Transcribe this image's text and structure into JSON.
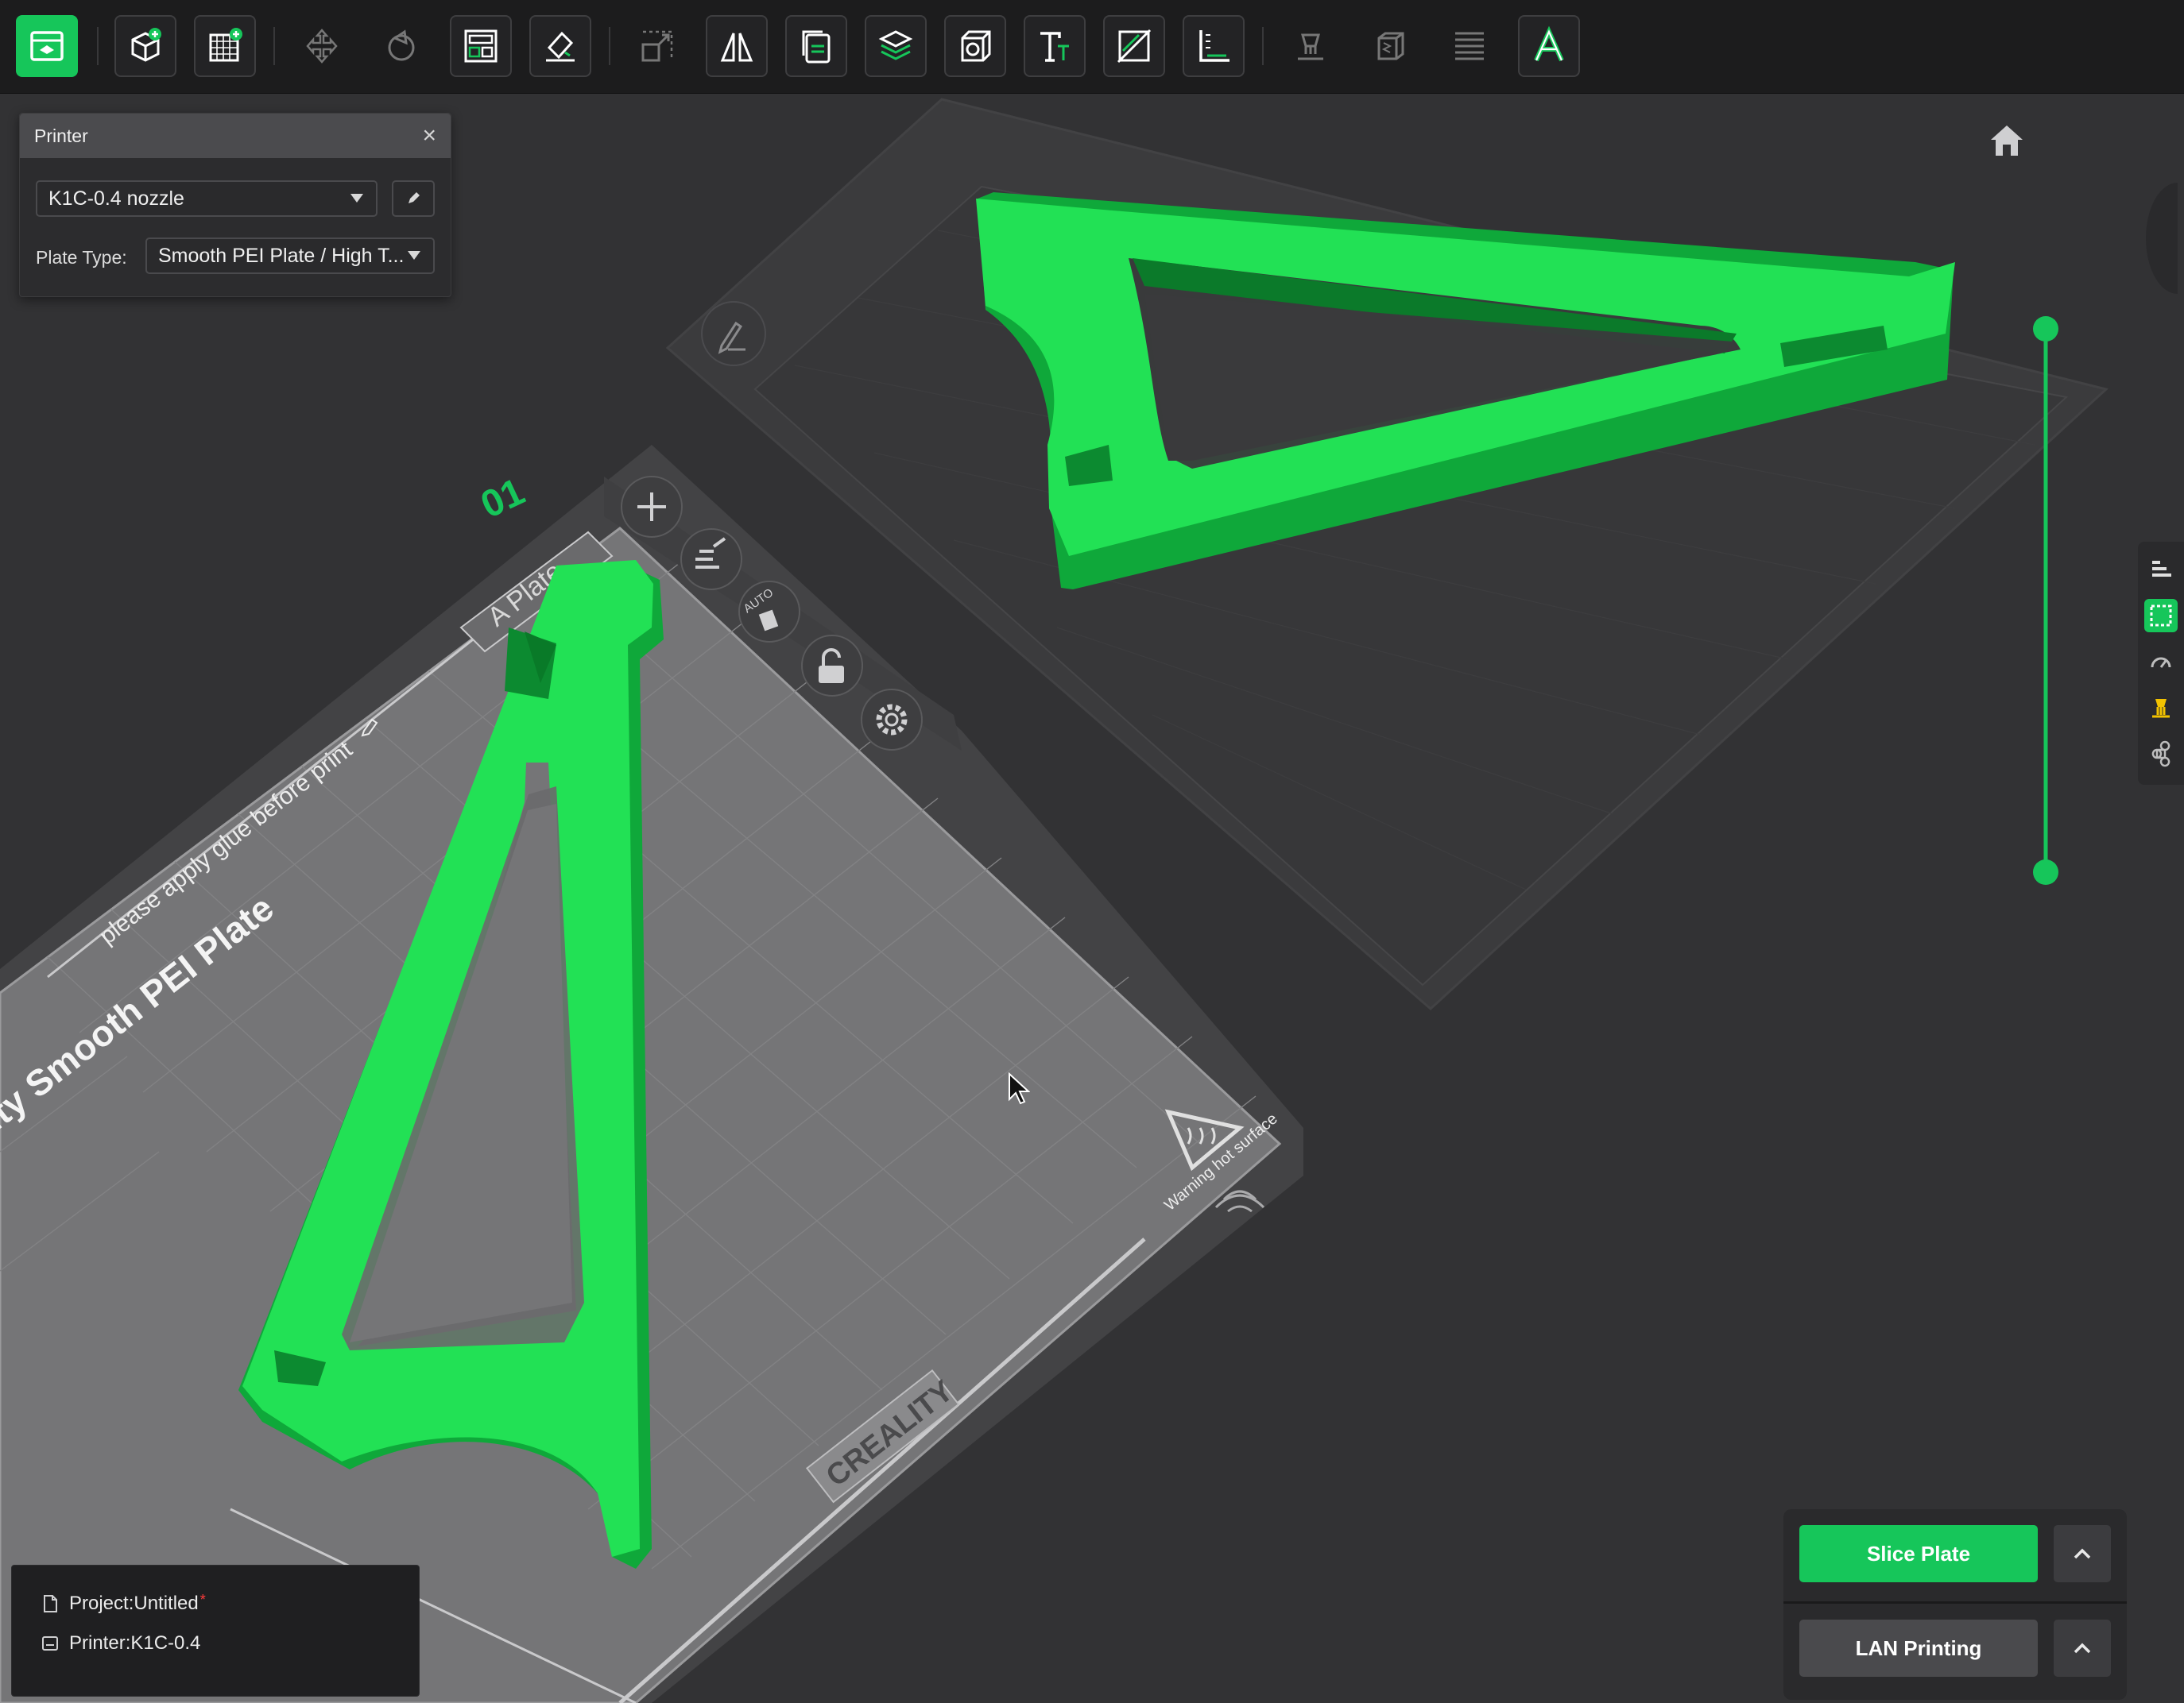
{
  "toolbar": {
    "buttons": [
      {
        "name": "prepare-view",
        "icon": "prepare-icon"
      },
      {
        "name": "add-object",
        "icon": "add-cube-icon"
      },
      {
        "name": "add-plate",
        "icon": "add-plate-icon"
      },
      {
        "name": "move",
        "icon": "move-icon"
      },
      {
        "name": "rotate",
        "icon": "rotate-icon"
      },
      {
        "name": "arrange",
        "icon": "arrange-icon"
      },
      {
        "name": "lay-on-face",
        "icon": "lay-on-face-icon"
      },
      {
        "name": "scale",
        "icon": "scale-icon"
      },
      {
        "name": "mirror",
        "icon": "mirror-icon"
      },
      {
        "name": "clone",
        "icon": "clone-icon"
      },
      {
        "name": "slice-layers",
        "icon": "layers-icon"
      },
      {
        "name": "hollow",
        "icon": "hollow-cube-icon"
      },
      {
        "name": "text",
        "icon": "text-icon"
      },
      {
        "name": "cut",
        "icon": "cut-icon"
      },
      {
        "name": "measure",
        "icon": "measure-icon"
      },
      {
        "name": "support-paint",
        "icon": "support-paint-icon"
      },
      {
        "name": "seam-paint",
        "icon": "seam-icon"
      },
      {
        "name": "variable-layer",
        "icon": "variable-layer-icon"
      },
      {
        "name": "emboss",
        "icon": "emboss-icon"
      }
    ]
  },
  "printer_panel": {
    "title": "Printer",
    "printer_select": "K1C-0.4 nozzle",
    "plate_type_label": "Plate Type:",
    "plate_type_select": "Smooth PEI Plate / High T..."
  },
  "plate": {
    "number": "01",
    "name_label": "A Plate",
    "glue_text": "please apply glue before print",
    "bed_text": "ity Smooth PEI Plate",
    "brand": "CREALITY",
    "warning": "Warning hot surface",
    "auto_label": "AUTO"
  },
  "status": {
    "project": "Project:Untitled",
    "dirty_marker": "*",
    "printer": "Printer:K1C-0.4"
  },
  "actions": {
    "slice": "Slice Plate",
    "lan": "LAN Printing"
  },
  "colors": {
    "accent": "#16c65a",
    "model": "#1ee04e",
    "background": "#323234"
  }
}
